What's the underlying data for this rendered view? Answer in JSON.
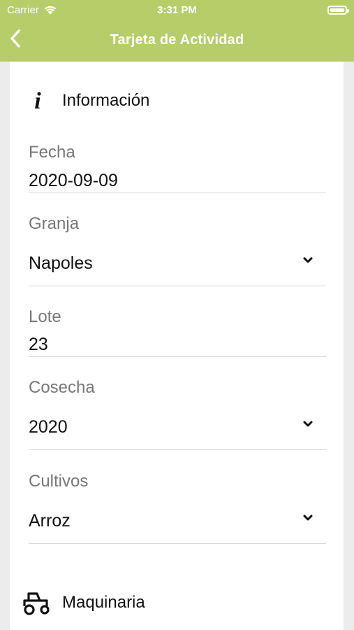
{
  "status_bar": {
    "carrier": "Carrier",
    "time": "3:31 PM",
    "wifi_icon": "wifi-icon",
    "battery_icon": "battery-icon"
  },
  "nav": {
    "title": "Tarjeta de Actividad",
    "back_icon": "chevron-left-icon"
  },
  "sections": {
    "info": {
      "title": "Información",
      "icon": "info-icon"
    },
    "machinery": {
      "title": "Maquinaria",
      "icon": "tractor-icon"
    }
  },
  "form": {
    "fecha": {
      "label": "Fecha",
      "value": "2020-09-09"
    },
    "granja": {
      "label": "Granja",
      "value": "Napoles"
    },
    "lote": {
      "label": "Lote",
      "value": "23"
    },
    "cosecha": {
      "label": "Cosecha",
      "value": "2020"
    },
    "cultivos": {
      "label": "Cultivos",
      "value": "Arroz"
    }
  },
  "colors": {
    "header": "#b6cd69",
    "background": "#ececec",
    "card": "#ffffff",
    "label": "#777777",
    "text": "#111111",
    "divider": "#d9d9d9"
  }
}
